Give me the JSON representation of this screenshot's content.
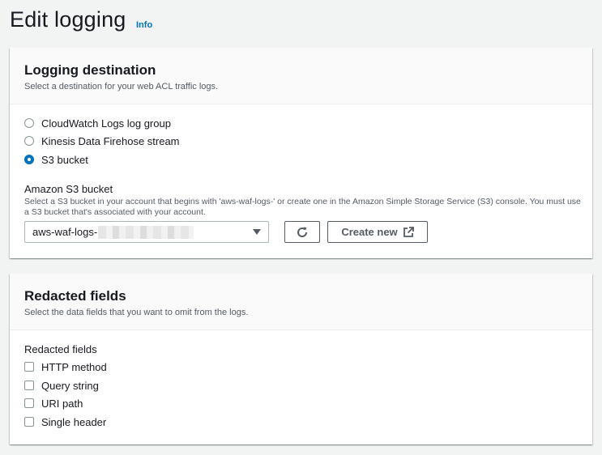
{
  "page": {
    "title": "Edit logging",
    "info_link": "Info"
  },
  "logging_destination": {
    "title": "Logging destination",
    "description": "Select a destination for your web ACL traffic logs.",
    "options": [
      {
        "label": "CloudWatch Logs log group",
        "selected": false
      },
      {
        "label": "Kinesis Data Firehose stream",
        "selected": false
      },
      {
        "label": "S3 bucket",
        "selected": true
      }
    ],
    "s3_bucket": {
      "label": "Amazon S3 bucket",
      "description": "Select a S3 bucket in your account that begins with 'aws-waf-logs-' or create one in the Amazon Simple Storage Service (S3) console. You must use a S3 bucket that's associated with your account.",
      "selected_value": "aws-waf-logs-",
      "refresh_icon": "refresh-icon",
      "create_label": "Create new",
      "external_icon": "external-link-icon"
    }
  },
  "redacted_fields": {
    "title": "Redacted fields",
    "description": "Select the data fields that you want to omit from the logs.",
    "group_label": "Redacted fields",
    "options": [
      {
        "label": "HTTP method",
        "checked": false
      },
      {
        "label": "Query string",
        "checked": false
      },
      {
        "label": "URI path",
        "checked": false
      },
      {
        "label": "Single header",
        "checked": false
      }
    ]
  },
  "colors": {
    "accent": "#0073bb",
    "background": "#f2f3f3",
    "text": "#16191f",
    "secondary_text": "#545b64"
  }
}
